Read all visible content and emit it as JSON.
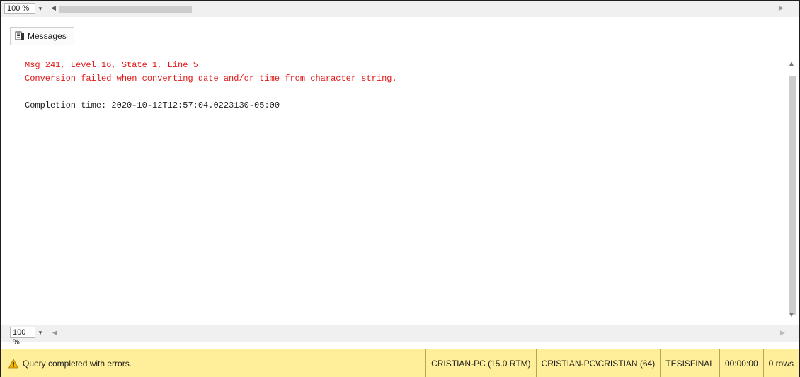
{
  "top_zoom": {
    "value": "100 %"
  },
  "tab": {
    "label": "Messages"
  },
  "messages": {
    "error_line1": "Msg 241, Level 16, State 1, Line 5",
    "error_line2": "Conversion failed when converting date and/or time from character string.",
    "completion": "Completion time: 2020-10-12T12:57:04.0223130-05:00"
  },
  "bottom_zoom": {
    "value": "100 %"
  },
  "status": {
    "text": "Query completed with errors.",
    "server": "CRISTIAN-PC (15.0 RTM)",
    "user": "CRISTIAN-PC\\CRISTIAN (64)",
    "database": "TESISFINAL",
    "elapsed": "00:00:00",
    "rows": "0 rows"
  },
  "colors": {
    "error_text": "#e01a1a",
    "status_bg": "#ffef9a"
  },
  "icons": [
    "chevron-down-icon",
    "arrow-left-icon",
    "arrow-right-icon",
    "messages-icon",
    "arrow-up-icon",
    "arrow-down-icon",
    "warning-icon"
  ]
}
